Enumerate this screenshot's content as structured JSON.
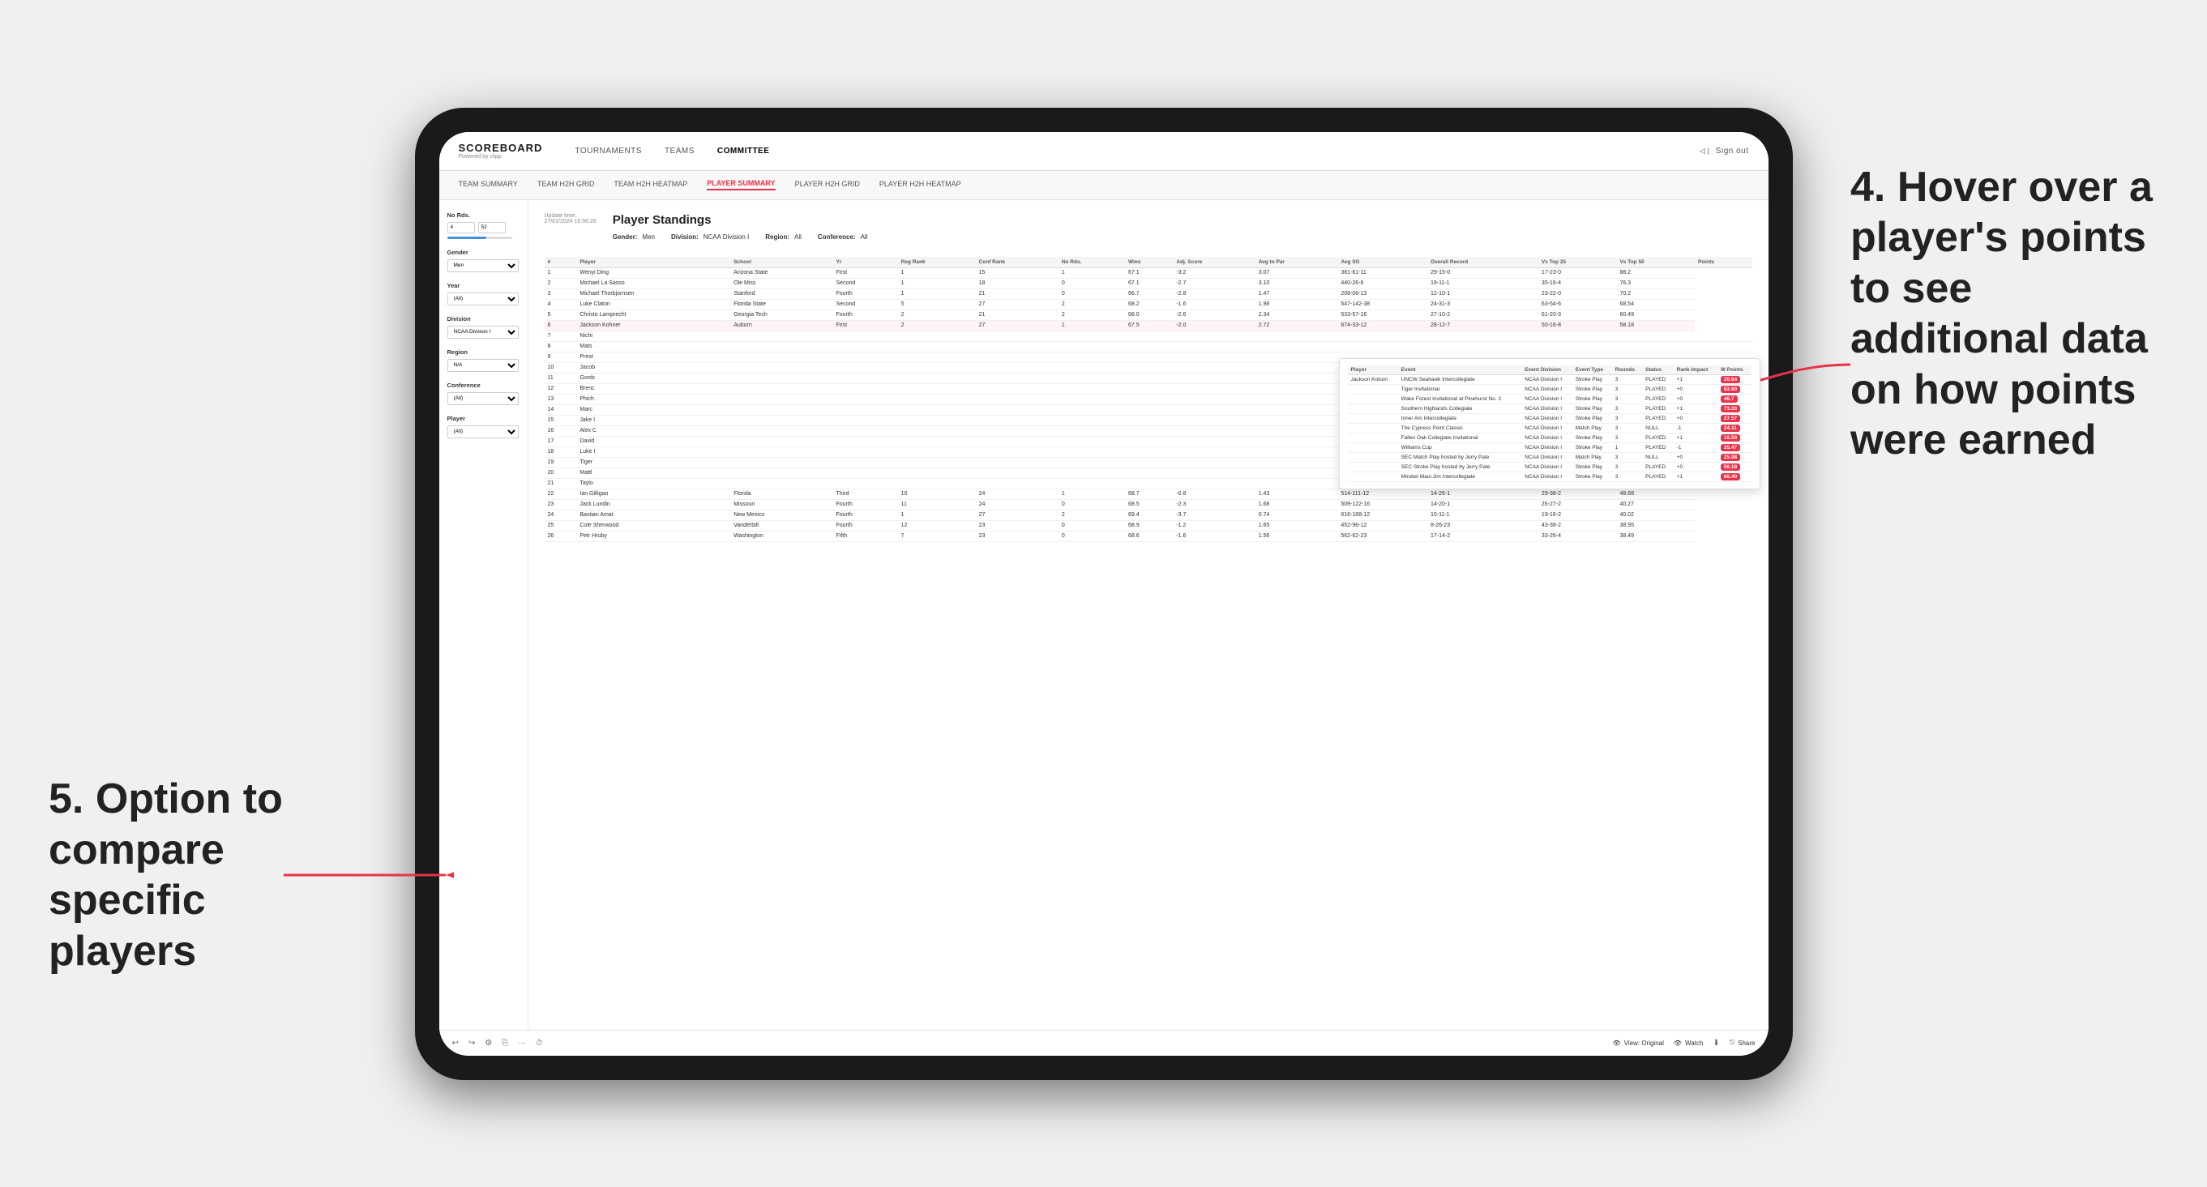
{
  "annotations": {
    "right": "4. Hover over a player's points to see additional data on how points were earned",
    "left": "5. Option to compare specific players"
  },
  "nav": {
    "logo": "SCOREBOARD",
    "logo_sub": "Powered by clipp",
    "links": [
      "TOURNAMENTS",
      "TEAMS",
      "COMMITTEE"
    ],
    "sign_out": "Sign out"
  },
  "sub_nav": {
    "links": [
      "TEAM SUMMARY",
      "TEAM H2H GRID",
      "TEAM H2H HEATMAP",
      "PLAYER SUMMARY",
      "PLAYER H2H GRID",
      "PLAYER H2H HEATMAP"
    ],
    "active": "PLAYER SUMMARY"
  },
  "sidebar": {
    "no_rds_label": "No Rds.",
    "no_rds_from": "4",
    "no_rds_to": "52",
    "gender_label": "Gender",
    "gender_value": "Men",
    "year_label": "Year",
    "year_value": "(All)",
    "division_label": "Division",
    "division_value": "NCAA Division I",
    "region_label": "Region",
    "region_value": "N/A",
    "conference_label": "Conference",
    "conference_value": "(All)",
    "player_label": "Player",
    "player_value": "(All)"
  },
  "content": {
    "update_time": "Update time:",
    "update_date": "27/01/2024 16:56:26",
    "title": "Player Standings",
    "filters": {
      "gender_label": "Gender:",
      "gender_value": "Men",
      "division_label": "Division:",
      "division_value": "NCAA Division I",
      "region_label": "Region:",
      "region_value": "All",
      "conference_label": "Conference:",
      "conference_value": "All"
    }
  },
  "table": {
    "headers": [
      "#",
      "Player",
      "School",
      "Yr",
      "Reg Rank",
      "Conf Rank",
      "No Rds.",
      "Wins",
      "Adj. Score",
      "Avg to Par",
      "Avg SG",
      "Overall Record",
      "Vs Top 25",
      "Vs Top 50",
      "Points"
    ],
    "rows": [
      [
        "1",
        "Wenyi Ding",
        "Arizona State",
        "First",
        "1",
        "15",
        "1",
        "67.1",
        "-3.2",
        "3.07",
        "381-61-11",
        "29-15-0",
        "17-23-0",
        "88.2"
      ],
      [
        "2",
        "Michael La Sasso",
        "Ole Miss",
        "Second",
        "1",
        "18",
        "0",
        "67.1",
        "-2.7",
        "3.10",
        "440-26-6",
        "19-11-1",
        "35-16-4",
        "76.3"
      ],
      [
        "3",
        "Michael Thorbjornsen",
        "Stanford",
        "Fourth",
        "1",
        "21",
        "0",
        "66.7",
        "-2.8",
        "1.47",
        "208-06-13",
        "12-10-1",
        "23-22-0",
        "70.2"
      ],
      [
        "4",
        "Luke Claton",
        "Florida State",
        "Second",
        "5",
        "27",
        "2",
        "68.2",
        "-1.6",
        "1.98",
        "547-142-38",
        "24-31-3",
        "63-54-6",
        "68.54"
      ],
      [
        "5",
        "Christo Lamprecht",
        "Georgia Tech",
        "Fourth",
        "2",
        "21",
        "2",
        "68.0",
        "-2.6",
        "2.34",
        "533-57-16",
        "27-10-2",
        "61-20-3",
        "60.49"
      ],
      [
        "6",
        "Jackson Kohner",
        "Auburn",
        "First",
        "2",
        "27",
        "1",
        "67.5",
        "-2.0",
        "2.72",
        "674-33-12",
        "28-12-7",
        "50-16-8",
        "58.18"
      ],
      [
        "7",
        "Nichi",
        "",
        "",
        "",
        "",
        "",
        "",
        "",
        "",
        "",
        "",
        "",
        "",
        ""
      ],
      [
        "8",
        "Mats",
        "",
        "",
        "",
        "",
        "",
        "",
        "",
        "",
        "",
        "",
        "",
        "",
        ""
      ],
      [
        "9",
        "Prest",
        "",
        "",
        "",
        "",
        "",
        "",
        "",
        "",
        "",
        "",
        "",
        "",
        ""
      ],
      [
        "10",
        "Jacob",
        "",
        "",
        "",
        "",
        "",
        "",
        "",
        "",
        "",
        "",
        "",
        "",
        ""
      ],
      [
        "11",
        "Gordc",
        "",
        "",
        "",
        "",
        "",
        "",
        "",
        "",
        "",
        "",
        "",
        "",
        ""
      ],
      [
        "12",
        "Brenc",
        "",
        "",
        "",
        "",
        "",
        "",
        "",
        "",
        "",
        "",
        "",
        "",
        ""
      ],
      [
        "13",
        "Phich",
        "",
        "",
        "",
        "",
        "",
        "",
        "",
        "",
        "",
        "",
        "",
        "",
        ""
      ],
      [
        "14",
        "Marc",
        "",
        "",
        "",
        "",
        "",
        "",
        "",
        "",
        "",
        "",
        "",
        "",
        ""
      ],
      [
        "15",
        "Jake I",
        "",
        "",
        "",
        "",
        "",
        "",
        "",
        "",
        "",
        "",
        "",
        "",
        ""
      ],
      [
        "16",
        "Alex C",
        "",
        "",
        "",
        "",
        "",
        "",
        "",
        "",
        "",
        "",
        "",
        "",
        ""
      ],
      [
        "17",
        "David",
        "",
        "",
        "",
        "",
        "",
        "",
        "",
        "",
        "",
        "",
        "",
        "",
        ""
      ],
      [
        "18",
        "Luke I",
        "",
        "",
        "",
        "",
        "",
        "",
        "",
        "",
        "",
        "",
        "",
        "",
        ""
      ],
      [
        "19",
        "Tiger",
        "",
        "",
        "",
        "",
        "",
        "",
        "",
        "",
        "",
        "",
        "",
        "",
        ""
      ],
      [
        "20",
        "Mattl",
        "",
        "",
        "",
        "",
        "",
        "",
        "",
        "",
        "",
        "",
        "",
        "",
        ""
      ],
      [
        "21",
        "Taylo",
        "",
        "",
        "",
        "",
        "",
        "",
        "",
        "",
        "",
        "",
        "",
        "",
        ""
      ],
      [
        "22",
        "Ian Gilligan",
        "Florida",
        "Third",
        "10",
        "24",
        "1",
        "68.7",
        "-0.8",
        "1.43",
        "514-111-12",
        "14-26-1",
        "29-38-2",
        "48.68"
      ],
      [
        "23",
        "Jack Lundin",
        "Missouri",
        "Fourth",
        "11",
        "24",
        "0",
        "68.5",
        "-2.3",
        "1.68",
        "509-122-16",
        "14-20-1",
        "26-27-2",
        "40.27"
      ],
      [
        "24",
        "Bastian Amat",
        "New Mexico",
        "Fourth",
        "1",
        "27",
        "2",
        "69.4",
        "-3.7",
        "0.74",
        "616-168-12",
        "10-11-1",
        "19-16-2",
        "40.02"
      ],
      [
        "25",
        "Cole Sherwood",
        "Vanderbilt",
        "Fourth",
        "12",
        "23",
        "0",
        "68.9",
        "-1.2",
        "1.65",
        "452-96-12",
        "8-26-23",
        "43-38-2",
        "38.95"
      ],
      [
        "26",
        "Petr Hruby",
        "Washington",
        "Fifth",
        "7",
        "23",
        "0",
        "68.6",
        "-1.6",
        "1.56",
        "562-62-23",
        "17-14-2",
        "33-26-4",
        "38.49"
      ]
    ]
  },
  "tooltip": {
    "player_name": "Jackson Kolson",
    "headers": [
      "Player",
      "Event",
      "Event Division",
      "Event Type",
      "Rounds",
      "Status",
      "Rank Impact",
      "W Points"
    ],
    "rows": [
      [
        "Jackson Kolson",
        "UNCW Seahawk Intercollegiate",
        "NCAA Division I",
        "Stroke Play",
        "3",
        "PLAYED",
        "+1",
        "20.64"
      ],
      [
        "",
        "Tiger Invitational",
        "NCAA Division I",
        "Stroke Play",
        "3",
        "PLAYED",
        "+0",
        "53.60"
      ],
      [
        "",
        "Wake Forest Invitational at Pinehurst No. 2",
        "NCAA Division I",
        "Stroke Play",
        "3",
        "PLAYED",
        "+0",
        "46.7"
      ],
      [
        "",
        "Southern Highlands Collegiate",
        "NCAA Division I",
        "Stroke Play",
        "3",
        "PLAYED",
        "+1",
        "73.33"
      ],
      [
        "",
        "Inner Am Intercollegiate",
        "NCAA Division I",
        "Stroke Play",
        "3",
        "PLAYED",
        "+0",
        "27.57"
      ],
      [
        "",
        "The Cypress Point Classic",
        "NCAA Division I",
        "Match Play",
        "3",
        "NULL",
        "-1",
        "24.11"
      ],
      [
        "",
        "Fallen Oak Collegiate Invitational",
        "NCAA Division I",
        "Stroke Play",
        "3",
        "PLAYED",
        "+1",
        "16.50"
      ],
      [
        "",
        "Williams Cup",
        "NCAA Division I",
        "Stroke Play",
        "1",
        "PLAYED",
        "-1",
        "35.47"
      ],
      [
        "",
        "SEC Match Play hosted by Jerry Pate",
        "NCAA Division I",
        "Match Play",
        "3",
        "NULL",
        "+0",
        "25.98"
      ],
      [
        "",
        "SEC Stroke Play hosted by Jerry Pate",
        "NCAA Division I",
        "Stroke Play",
        "3",
        "PLAYED",
        "+0",
        "56.18"
      ],
      [
        "",
        "Mirobel Maui Jim Intercollegiate",
        "NCAA Division I",
        "Stroke Play",
        "3",
        "PLAYED",
        "+1",
        "66.40"
      ]
    ]
  },
  "toolbar": {
    "view_label": "View: Original",
    "watch_label": "Watch",
    "share_label": "Share"
  }
}
